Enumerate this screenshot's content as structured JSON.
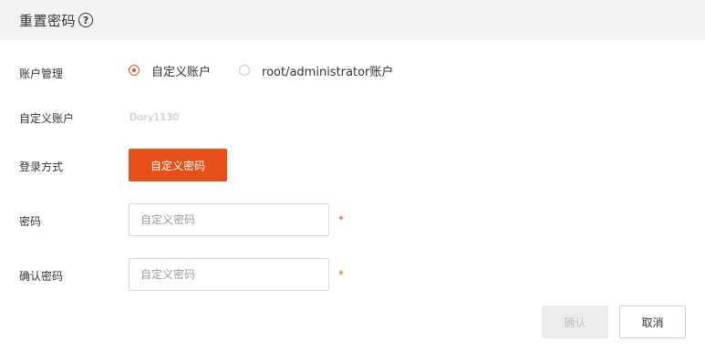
{
  "dialog": {
    "title": "重置密码",
    "help_icon": "question-circle-icon"
  },
  "form": {
    "account_management": {
      "label": "账户管理",
      "options": [
        {
          "label": "自定义账户",
          "selected": true
        },
        {
          "label": "root/administrator账户",
          "selected": false
        }
      ]
    },
    "custom_account": {
      "label": "自定义账户",
      "value": "Dory1130"
    },
    "login_method": {
      "label": "登录方式",
      "button_label": "自定义密码"
    },
    "password": {
      "label": "密码",
      "value": "",
      "placeholder": "自定义密码",
      "required_mark": "*"
    },
    "confirm_password": {
      "label": "确认密码",
      "value": "",
      "placeholder": "自定义密码",
      "required_mark": "*"
    }
  },
  "footer": {
    "confirm_label": "确认",
    "cancel_label": "取消"
  },
  "colors": {
    "accent": "#e8501a",
    "header_bg": "#f2f2f2",
    "disabled_bg": "#ececec"
  }
}
